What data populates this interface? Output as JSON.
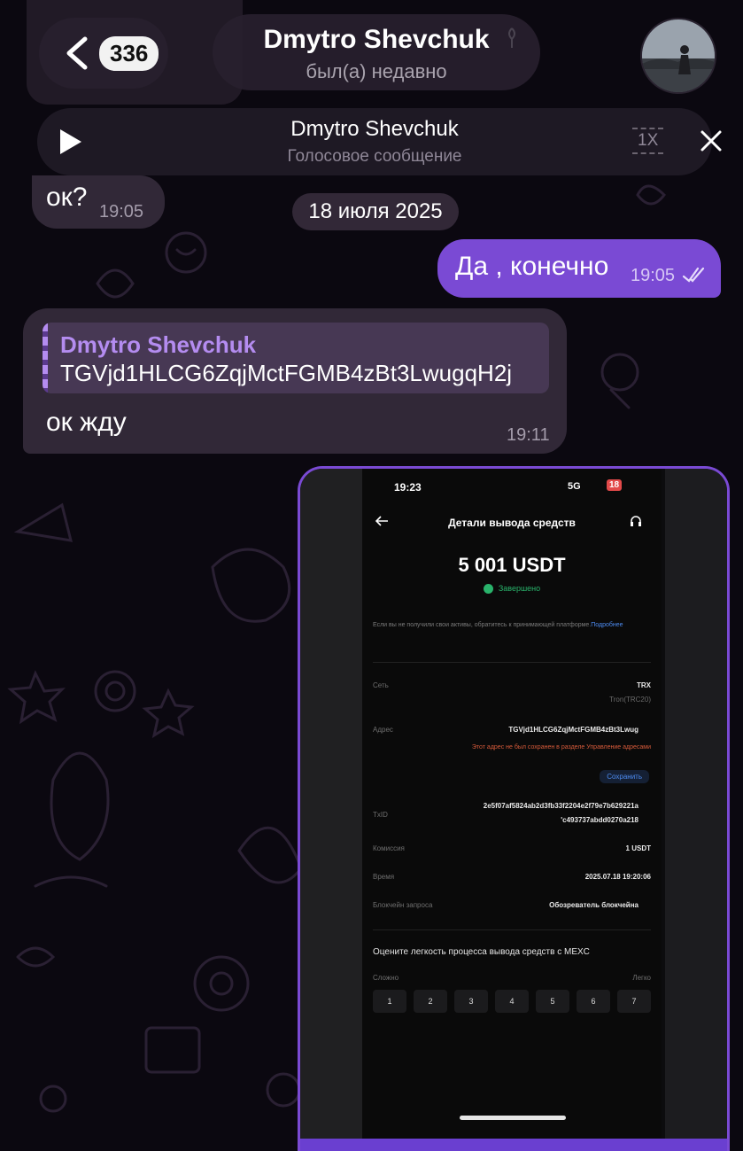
{
  "header": {
    "back_badge": "336",
    "contact_name": "Dmytro Shevchuk",
    "contact_status": "был(а) недавно"
  },
  "audio_player": {
    "title": "Dmytro Shevchuk",
    "subtitle": "Голосовое сообщение",
    "speed": "1X"
  },
  "messages": {
    "ok_text": "ок?",
    "ok_time": "19:05",
    "date_separator": "18 июля 2025",
    "out_text": "Да , конечно",
    "out_time": "19:05",
    "reply_quote_name": "Dmytro Shevchuk",
    "reply_quote_text": "TGVjd1HLCG6ZqjMctFGMB4zBt3LwugqH2j",
    "reply_text": "ок жду",
    "reply_time": "19:11"
  },
  "screenshot": {
    "status_time": "19:23",
    "signal": "5G",
    "battery": "18",
    "header_title": "Детали вывода средств",
    "amount": "5 001 USDT",
    "status": "Завершено",
    "note": "Если вы не получили свои активы, обратитесь к принимающей платформе.",
    "note_link": "Подробнее",
    "network_label": "Сеть",
    "network_value": "TRX",
    "network_sub": "Tron(TRC20)",
    "address_label": "Адрес",
    "address_value": "TGVjd1HLCG6ZqjMctFGMB4zBt3Lwug",
    "address_warning": "Этот адрес не был сохранен в разделе Управление адресами",
    "save_label": "Сохранить",
    "txid_label": "TxID",
    "txid_line1": "2e5f07af5824ab2d3fb33f2204e2f79e7b629221a",
    "txid_line2": "'c493737abdd0270a218",
    "fee_label": "Комиссия",
    "fee_value": "1 USDT",
    "time_label": "Время",
    "time_value": "2025.07.18 19:20:06",
    "chain_label": "Блокчейн запроса",
    "chain_value": "Обозреватель блокчейна",
    "rate_question": "Оцените легкость процесса вывода средств с MEXC",
    "rate_left": "Сложно",
    "rate_right": "Легко",
    "rates": [
      "1",
      "2",
      "3",
      "4",
      "5",
      "6",
      "7"
    ]
  },
  "colors": {
    "accent": "#7a4ad4",
    "quote_name": "#b48cf0",
    "bubble_in": "#342a3a"
  }
}
